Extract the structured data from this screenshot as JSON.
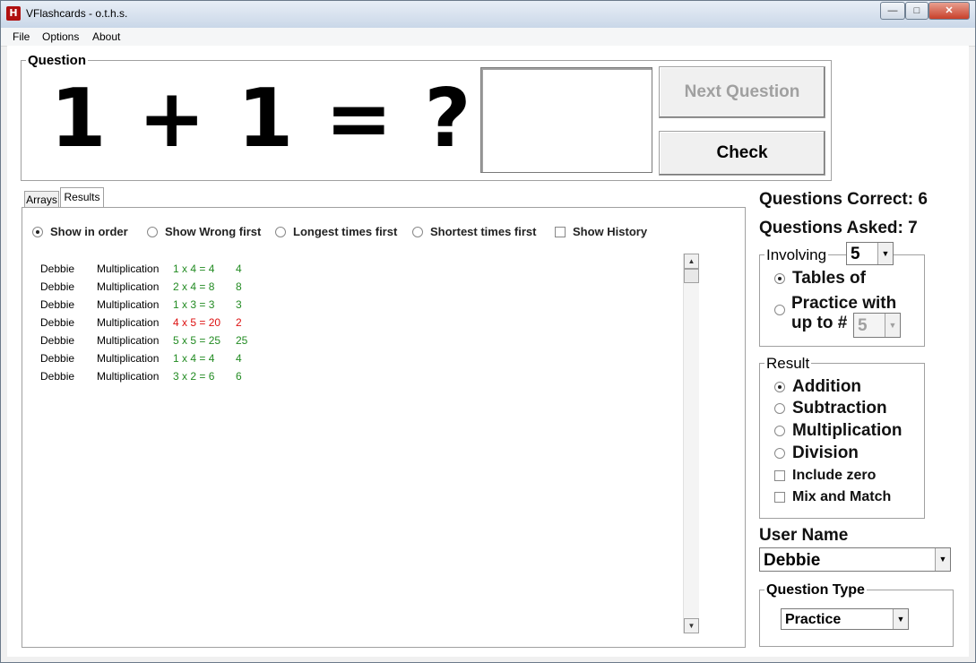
{
  "window": {
    "title": "VFlashcards - o.t.h.s.",
    "icon_glyph": "H",
    "controls": {
      "minimize": "—",
      "maximize": "□",
      "close": "✕"
    }
  },
  "menu": [
    "File",
    "Options",
    "About"
  ],
  "question": {
    "legend": "Question",
    "equation": "1 + 1 = ?",
    "answer_value": "",
    "next_button": "Next Question",
    "check_button": "Check"
  },
  "tabs": [
    "Arrays",
    "Results"
  ],
  "results": {
    "filters": [
      {
        "label": "Show in order",
        "type": "radio",
        "checked": true
      },
      {
        "label": "Show Wrong first",
        "type": "radio",
        "checked": false
      },
      {
        "label": "Longest times first",
        "type": "radio",
        "checked": false
      },
      {
        "label": "Shortest times first",
        "type": "radio",
        "checked": false
      },
      {
        "label": "Show History",
        "type": "checkbox",
        "checked": false
      }
    ],
    "rows": [
      {
        "name": "Debbie",
        "op": "Multiplication",
        "equation": "1 x 4 = 4",
        "answer": "4",
        "correct": true
      },
      {
        "name": "Debbie",
        "op": "Multiplication",
        "equation": "2 x 4 = 8",
        "answer": "8",
        "correct": true
      },
      {
        "name": "Debbie",
        "op": "Multiplication",
        "equation": "1 x 3 = 3",
        "answer": "3",
        "correct": true
      },
      {
        "name": "Debbie",
        "op": "Multiplication",
        "equation": "4 x 5 = 20",
        "answer": "2",
        "correct": false
      },
      {
        "name": "Debbie",
        "op": "Multiplication",
        "equation": "5 x 5 = 25",
        "answer": "25",
        "correct": true
      },
      {
        "name": "Debbie",
        "op": "Multiplication",
        "equation": "1 x 4 = 4",
        "answer": "4",
        "correct": true
      },
      {
        "name": "Debbie",
        "op": "Multiplication",
        "equation": "3 x 2 = 6",
        "answer": "6",
        "correct": true
      }
    ],
    "scroll": {
      "up": "▲",
      "down": "▼"
    }
  },
  "stats": {
    "correct": "Questions Correct: 6",
    "asked": "Questions Asked: 7"
  },
  "involving": {
    "legend": "Involving",
    "value": "5",
    "tables_of": "Tables of",
    "practice_line1": "Practice with",
    "practice_line2": "up to #",
    "practice_value": "5",
    "selected": "tables_of"
  },
  "result_group": {
    "legend": "Result",
    "options": [
      "Addition",
      "Subtraction",
      "Multiplication",
      "Division"
    ],
    "selected": "Addition",
    "include_zero": "Include zero",
    "mix_and_match": "Mix and Match"
  },
  "user": {
    "label": "User Name",
    "value": "Debbie"
  },
  "question_type": {
    "legend": "Question Type",
    "value": "Practice"
  },
  "colors": {
    "correct": "#228b22",
    "wrong": "#dd1111",
    "dropdown_arrow": "▼"
  }
}
